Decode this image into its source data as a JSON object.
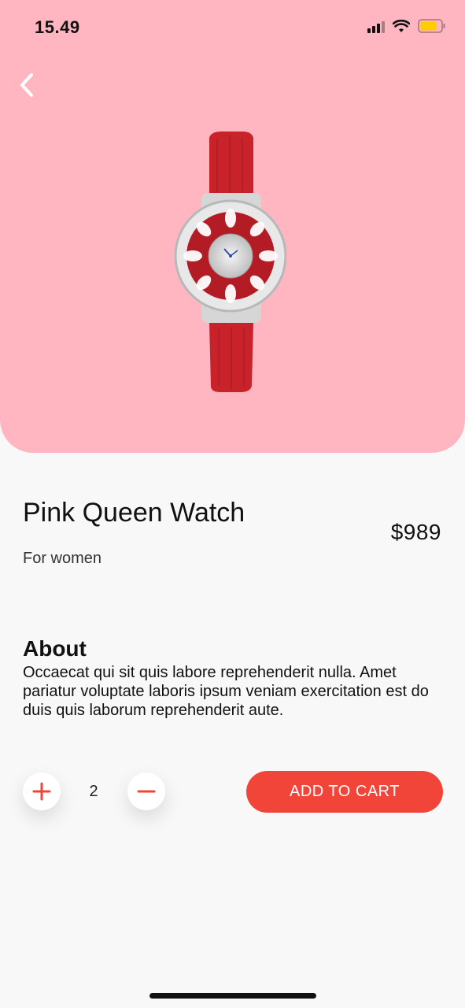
{
  "status_bar": {
    "time": "15.49"
  },
  "product": {
    "name": "Pink Queen Watch",
    "price": "$989",
    "category": "For women",
    "image_icon": "watch-image",
    "hero_color": "#ffb6c1"
  },
  "about": {
    "heading": "About",
    "text": "Occaecat qui sit quis labore reprehenderit nulla. Amet pariatur voluptate laboris ipsum veniam exercitation est do duis quis laborum reprehenderit aute."
  },
  "cart": {
    "quantity": "2",
    "add_label": "ADD TO CART",
    "accent": "#f2453a"
  }
}
